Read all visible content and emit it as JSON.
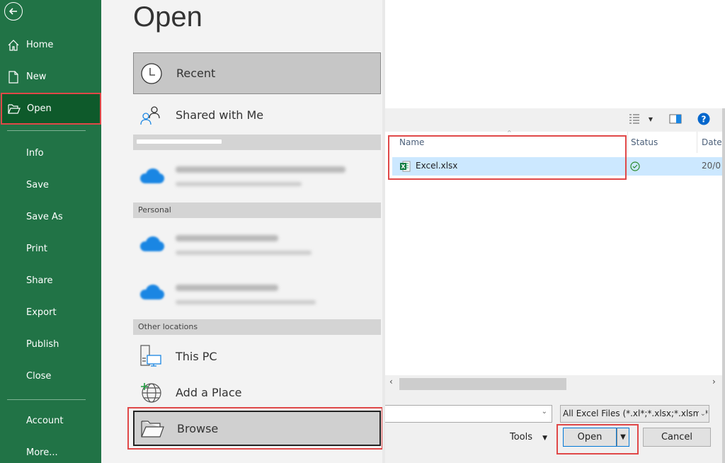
{
  "sidebar": {
    "back_icon": "back-arrow-icon",
    "items": [
      {
        "label": "Home",
        "icon": "home-icon"
      },
      {
        "label": "New",
        "icon": "new-document-icon"
      },
      {
        "label": "Open",
        "icon": "open-folder-icon",
        "active": true
      },
      {
        "label": "Info"
      },
      {
        "label": "Save"
      },
      {
        "label": "Save As"
      },
      {
        "label": "Print"
      },
      {
        "label": "Share"
      },
      {
        "label": "Export"
      },
      {
        "label": "Publish"
      },
      {
        "label": "Close"
      },
      {
        "label": "Account"
      },
      {
        "label": "More..."
      }
    ]
  },
  "open_panel": {
    "title": "Open",
    "recent_label": "Recent",
    "shared_label": "Shared with Me",
    "groups": {
      "business": "(redacted)",
      "personal": "Personal",
      "other": "Other locations"
    },
    "this_pc_label": "This PC",
    "add_place_label": "Add a Place",
    "browse_label": "Browse"
  },
  "dialog": {
    "columns": {
      "name": "Name",
      "status": "Status",
      "date": "Date"
    },
    "files": [
      {
        "name": "Excel.xlsx",
        "status": "synced",
        "date": "20/0"
      }
    ],
    "file_type_filter": "All Excel Files (*.xl*;*.xlsx;*.xlsm;*",
    "tools_label": "Tools",
    "open_label": "Open",
    "cancel_label": "Cancel",
    "filename_value": ""
  },
  "colors": {
    "excel_green": "#217346",
    "active_green": "#0e5a2b",
    "highlight_red": "#e04848",
    "selection_blue": "#cce8ff",
    "onedrive_blue": "#1a86e3"
  }
}
